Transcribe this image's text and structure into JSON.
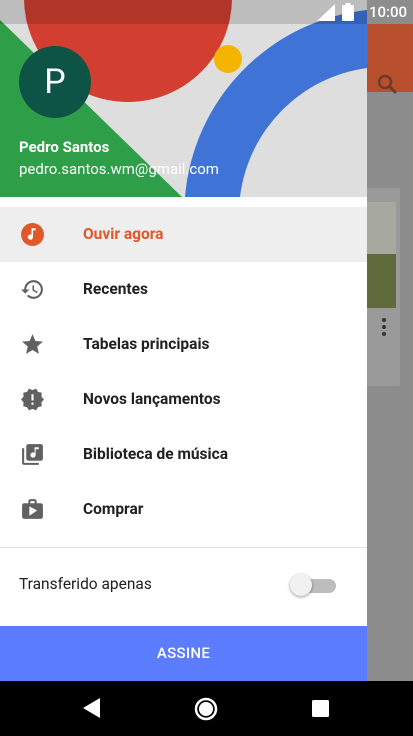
{
  "status_bar": {
    "time": "10:00"
  },
  "account": {
    "avatar_letter": "P",
    "name": "Pedro Santos",
    "email": "pedro.santos.wm@gmail.com"
  },
  "menu": {
    "items": [
      {
        "label": "Ouvir agora",
        "icon": "headphones-icon",
        "active": true
      },
      {
        "label": "Recentes",
        "icon": "history-icon",
        "active": false
      },
      {
        "label": "Tabelas principais",
        "icon": "star-icon",
        "active": false
      },
      {
        "label": "Novos lançamentos",
        "icon": "new-releases-icon",
        "active": false
      },
      {
        "label": "Biblioteca de música",
        "icon": "music-library-icon",
        "active": false
      },
      {
        "label": "Comprar",
        "icon": "play-store-icon",
        "active": false
      }
    ]
  },
  "downloaded_only": {
    "label": "Transferido apenas",
    "enabled": false
  },
  "subscribe": {
    "label": "ASSINE"
  },
  "colors": {
    "accent": "#e0582a",
    "subscribe": "#5b7dfd",
    "avatar": "#0d5346"
  }
}
